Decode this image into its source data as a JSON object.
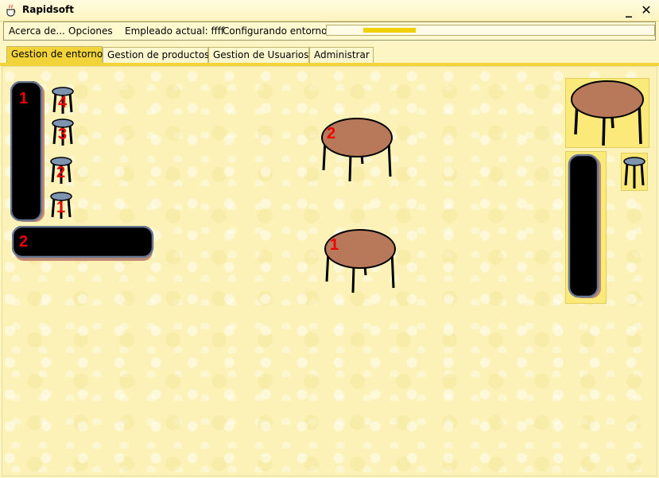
{
  "window": {
    "title": "Rapidsoft",
    "minimize_label": "_",
    "close_label": "✕",
    "icon": "java-cup-icon"
  },
  "menu": {
    "items": [
      "Acerca de...",
      "Opciones"
    ],
    "employee_label": "Empleado actual: ffff",
    "status_label": "Configurando entorno..."
  },
  "progress": {
    "fraction": 0.16
  },
  "tabs": [
    {
      "label": "Gestion de entorno",
      "active": true
    },
    {
      "label": "Gestion de productos",
      "active": false
    },
    {
      "label": "Gestion de Usuarios",
      "active": false
    },
    {
      "label": "Administrar",
      "active": false
    }
  ],
  "environment": {
    "bars": [
      {
        "number": "1",
        "orientation": "vertical"
      },
      {
        "number": "2",
        "orientation": "horizontal"
      }
    ],
    "stools": [
      {
        "number": "4"
      },
      {
        "number": "3"
      },
      {
        "number": "2"
      },
      {
        "number": "1"
      }
    ],
    "tables": [
      {
        "number": "2"
      },
      {
        "number": "1"
      }
    ]
  },
  "palette": {
    "items": [
      "round-table",
      "bar-counter",
      "stool"
    ]
  },
  "colors": {
    "accent": "#f2d43a",
    "tabletop": "#b8785a",
    "stool_seat": "#7d93b0",
    "number": "#f00000",
    "bar": "#000000"
  }
}
